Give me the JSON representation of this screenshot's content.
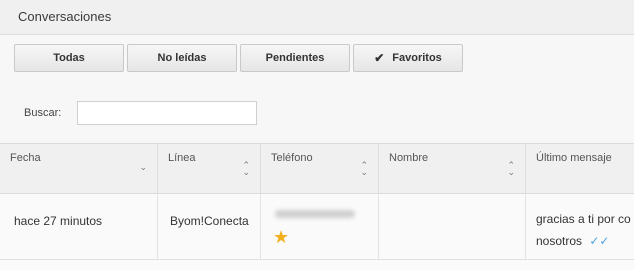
{
  "header": {
    "title": "Conversaciones"
  },
  "filters": [
    {
      "label": "Todas",
      "checked": false
    },
    {
      "label": "No leídas",
      "checked": false
    },
    {
      "label": "Pendientes",
      "checked": false
    },
    {
      "label": "Favoritos",
      "checked": true
    }
  ],
  "search": {
    "label": "Buscar:",
    "value": ""
  },
  "table": {
    "columns": [
      {
        "label": "Fecha",
        "sort": "desc"
      },
      {
        "label": "Línea",
        "sort": "both"
      },
      {
        "label": "Teléfono",
        "sort": "both"
      },
      {
        "label": "Nombre",
        "sort": "both"
      },
      {
        "label": "Último mensaje",
        "sort": "both"
      }
    ],
    "rows": [
      {
        "fecha": "hace 27 minutos",
        "linea": "Byom!Conecta",
        "telefono": "",
        "favorito": true,
        "nombre": "",
        "ultimo_mensaje_l1": "gracias a ti por co",
        "ultimo_mensaje_l2": "nosotros",
        "read_icon": "double-check-icon",
        "status_color": "#4aa3df"
      }
    ]
  }
}
